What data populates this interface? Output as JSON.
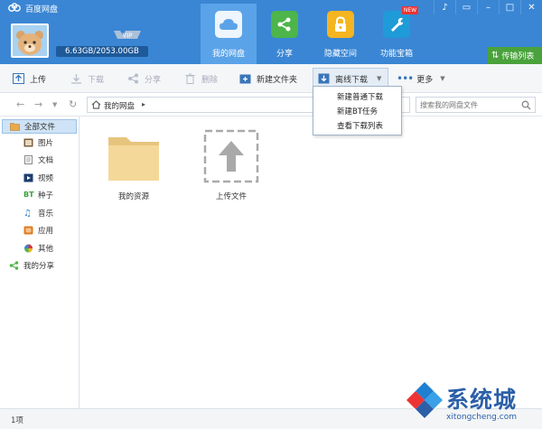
{
  "app": {
    "title": "百度网盘"
  },
  "window": {
    "controls": [
      "bell",
      "minimize-restore",
      "minimize",
      "maximize",
      "close"
    ]
  },
  "user": {
    "quota": "6.63GB/2053.00GB",
    "vip": "VIP"
  },
  "nav": [
    {
      "label": "我的网盘",
      "icon": "cloud-icon",
      "active": true,
      "color": "#e8f2fc"
    },
    {
      "label": "分享",
      "icon": "share-icon",
      "active": false,
      "color": "#4db54a"
    },
    {
      "label": "隐藏空间",
      "icon": "lock-icon",
      "active": false,
      "color": "#f4b521"
    },
    {
      "label": "功能宝箱",
      "icon": "wrench-icon",
      "active": false,
      "color": "#1f9bd7",
      "badge": "NEW"
    }
  ],
  "transfer": {
    "label": "传输列表"
  },
  "toolbar": {
    "upload": "上传",
    "download": "下载",
    "share": "分享",
    "delete": "删除",
    "new_folder": "新建文件夹",
    "offline_download": "离线下载",
    "more": "更多"
  },
  "dropdown": [
    "新建普通下载",
    "新建BT任务",
    "查看下载列表"
  ],
  "address": {
    "path": "我的网盘",
    "search_placeholder": "搜索我的网盘文件"
  },
  "sidebar": {
    "all": "全部文件",
    "items": [
      {
        "label": "图片",
        "icon": "image-icon",
        "color": "#7c5c3c"
      },
      {
        "label": "文档",
        "icon": "document-icon",
        "color": "#888888"
      },
      {
        "label": "视频",
        "icon": "video-icon",
        "color": "#1d3c6e"
      },
      {
        "label": "种子",
        "icon": "bt-icon",
        "color": "#3aa23a"
      },
      {
        "label": "音乐",
        "icon": "music-icon",
        "color": "#2f7dc7"
      },
      {
        "label": "应用",
        "icon": "app-icon",
        "color": "#e07b1f"
      },
      {
        "label": "其他",
        "icon": "other-icon",
        "color": "#d33"
      }
    ],
    "share": "我的分享"
  },
  "files": [
    {
      "label": "我的资源",
      "icon": "folder-icon"
    },
    {
      "label": "上传文件",
      "icon": "upload-placeholder-icon"
    }
  ],
  "status": {
    "count": "1项"
  },
  "watermark": {
    "text": "系统城",
    "url": "xitongcheng.com"
  }
}
